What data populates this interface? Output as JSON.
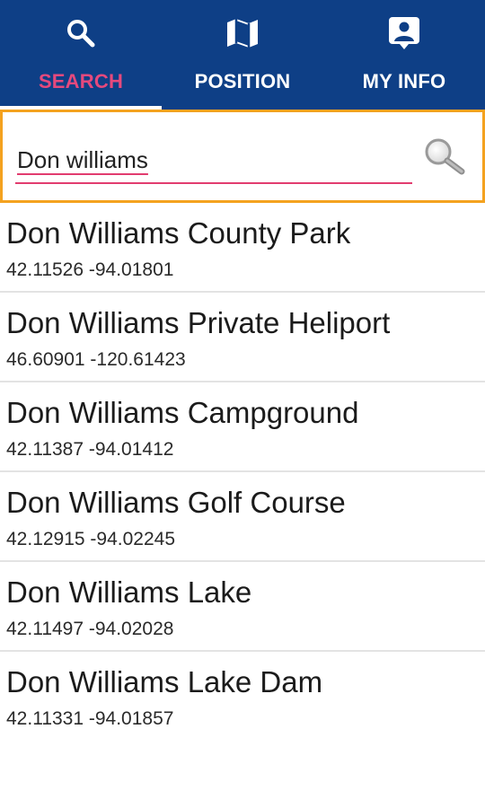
{
  "tabs": [
    {
      "label": "SEARCH",
      "icon": "search-icon",
      "active": true
    },
    {
      "label": "POSITION",
      "icon": "map-icon",
      "active": false
    },
    {
      "label": "MY INFO",
      "icon": "account-box-icon",
      "active": false
    }
  ],
  "search": {
    "value": "Don williams",
    "button_icon": "magnifier-icon"
  },
  "results": [
    {
      "name": "Don Williams County Park",
      "coords": "42.11526 -94.01801"
    },
    {
      "name": "Don Williams Private Heliport",
      "coords": "46.60901 -120.61423"
    },
    {
      "name": "Don Williams Campground",
      "coords": "42.11387 -94.01412"
    },
    {
      "name": "Don Williams Golf Course",
      "coords": "42.12915 -94.02245"
    },
    {
      "name": "Don Williams Lake",
      "coords": "42.11497 -94.02028"
    },
    {
      "name": "Don Williams Lake Dam",
      "coords": "42.11331 -94.01857"
    }
  ],
  "colors": {
    "header": "#0e3f86",
    "active_tab_label": "#e5497d",
    "search_border": "#f4a21f",
    "input_underline": "#e23c6f"
  }
}
